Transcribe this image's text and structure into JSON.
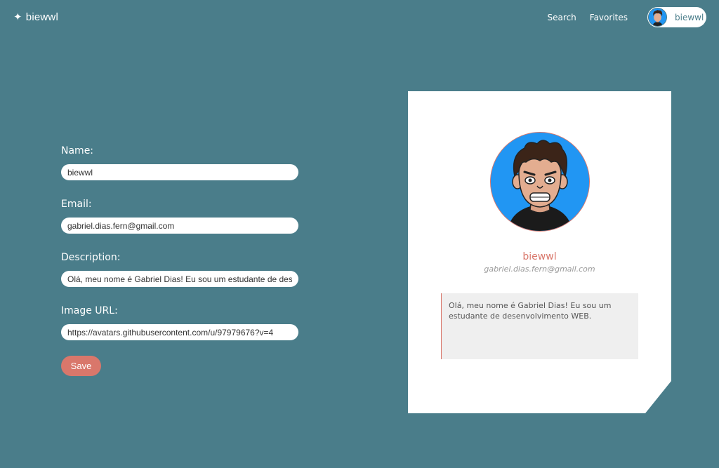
{
  "header": {
    "brand_icon": "✦",
    "brand": "biewwl",
    "nav": {
      "search": "Search",
      "favorites": "Favorites"
    },
    "user": {
      "name": "biewwl",
      "avatar_icon": "avatar-icon"
    }
  },
  "form": {
    "name_label": "Name:",
    "name_value": "biewwl",
    "email_label": "Email:",
    "email_value": "gabriel.dias.fern@gmail.com",
    "description_label": "Description:",
    "description_value": "Olá, meu nome é Gabriel Dias! Eu sou um estudante de desenvolvimento WEB.",
    "image_label": "Image URL:",
    "image_value": "https://avatars.githubusercontent.com/u/97979676?v=4",
    "save_label": "Save"
  },
  "profile": {
    "name": "biewwl",
    "email": "gabriel.dias.fern@gmail.com",
    "description": "Olá, meu nome é Gabriel Dias! Eu sou um estudante de desenvolvimento WEB."
  },
  "colors": {
    "background": "#4a7d8a",
    "accent": "#d9776b",
    "card": "#ffffff",
    "description_bg": "#efefef"
  }
}
